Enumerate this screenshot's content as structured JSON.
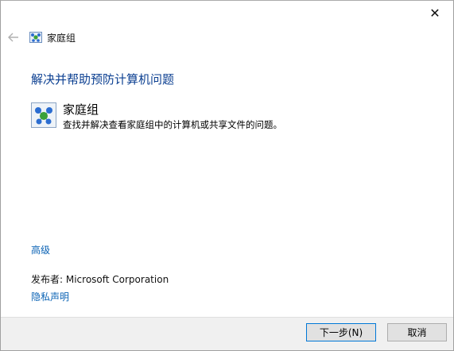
{
  "window": {
    "close_glyph": "✕"
  },
  "nav": {
    "back_icon": "back-arrow-icon",
    "title": "家庭组",
    "icon": "homegroup-icon"
  },
  "heading": "解决并帮助预防计算机问题",
  "troubleshooter": {
    "title": "家庭组",
    "description": "查找并解决查看家庭组中的计算机或共享文件的问题。",
    "icon": "homegroup-icon"
  },
  "advanced_link": "高级",
  "publisher": "发布者:  Microsoft Corporation",
  "privacy_link": "隐私声明",
  "buttons": {
    "next": "下一步(N)",
    "cancel": "取消"
  },
  "colors": {
    "heading": "#0b3f91",
    "link": "#0b63b5",
    "footer_bg": "#f0f0f0",
    "primary_border": "#0078d7"
  }
}
